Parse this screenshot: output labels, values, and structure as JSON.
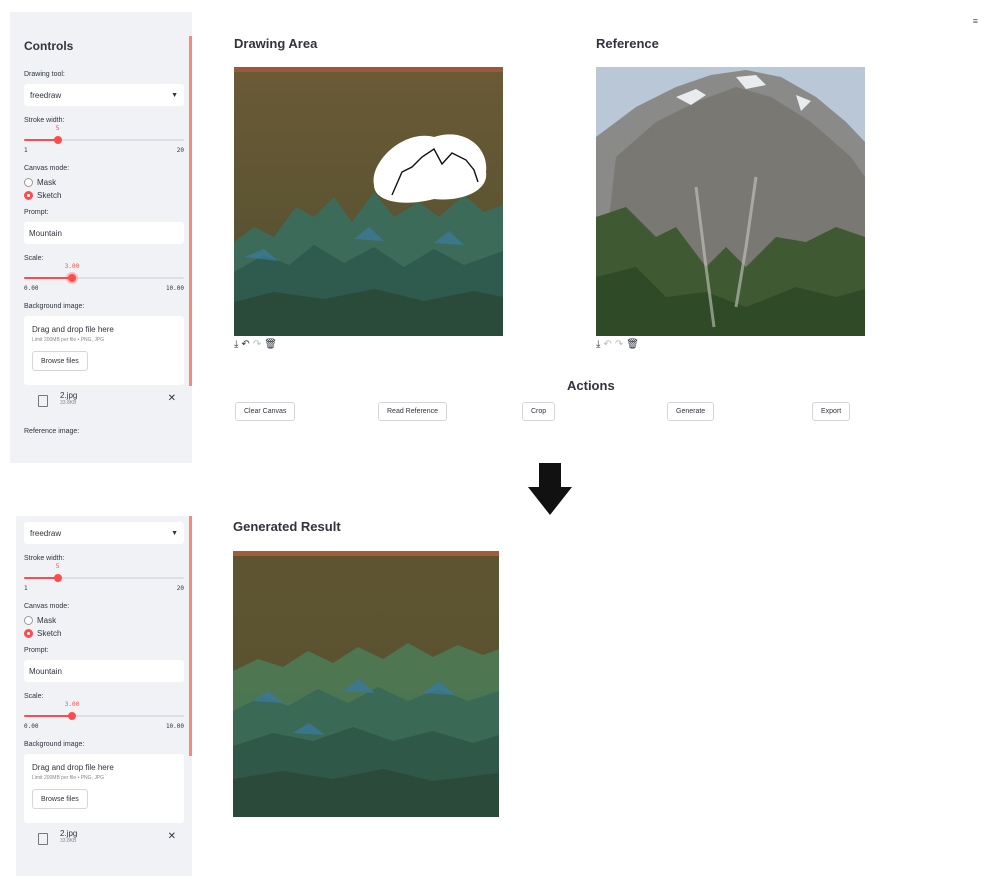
{
  "sidebar": {
    "title": "Controls",
    "drawing_tool_label": "Drawing tool:",
    "drawing_tool_value": "freedraw",
    "stroke_width_label": "Stroke width:",
    "stroke_width": {
      "value": "5",
      "min": "1",
      "max": "20",
      "fraction": 0.21
    },
    "canvas_mode_label": "Canvas mode:",
    "canvas_mode_options": [
      "Mask",
      "Sketch"
    ],
    "canvas_mode_selected": "Sketch",
    "prompt_label": "Prompt:",
    "prompt_value": "Mountain",
    "scale_label": "Scale:",
    "scale": {
      "value": "3.00",
      "min": "0.00",
      "max": "10.00",
      "fraction": 0.3
    },
    "bg_image_label": "Background image:",
    "upload_title": "Drag and drop file here",
    "upload_limit": "Limit 200MB per file • PNG, JPG",
    "browse_label": "Browse files",
    "file_name": "2.jpg",
    "file_size": "33.8KB",
    "ref_image_label": "Reference image:"
  },
  "main": {
    "drawing_area_title": "Drawing Area",
    "reference_title": "Reference",
    "actions_title": "Actions",
    "actions": [
      "Clear Canvas",
      "Read Reference",
      "Crop",
      "Generate",
      "Export"
    ],
    "generated_title": "Generated Result"
  },
  "icons": {
    "menu": "hamburger-icon",
    "download": "download-icon",
    "undo": "undo-icon",
    "redo": "redo-icon",
    "delete": "trash-icon",
    "arrow": "arrow-down-icon",
    "file": "file-icon",
    "close": "close-icon"
  },
  "colors": {
    "accent": "#ff4b4b",
    "sidebar_bg": "#f0f2f6",
    "text": "#31333f"
  }
}
